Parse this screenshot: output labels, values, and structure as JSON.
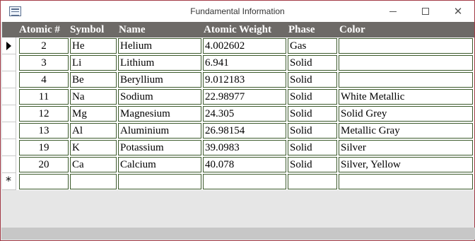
{
  "window": {
    "title": "Fundamental Information",
    "icon": "form-view-icon"
  },
  "controls": {
    "minimize_icon": "minimize-icon",
    "maximize_icon": "maximize-icon",
    "close_icon": "close-icon"
  },
  "table": {
    "headers": [
      "Atomic #",
      "Symbol",
      "Name",
      "Atomic Weight",
      "Phase",
      "Color"
    ],
    "rows": [
      [
        "2",
        "He",
        "Helium",
        "4.002602",
        "Gas",
        ""
      ],
      [
        "3",
        "Li",
        "Lithium",
        "6.941",
        "Solid",
        ""
      ],
      [
        "4",
        "Be",
        "Beryllium",
        "9.012183",
        "Solid",
        ""
      ],
      [
        "11",
        "Na",
        "Sodium",
        "22.98977",
        "Solid",
        "White Metallic"
      ],
      [
        "12",
        "Mg",
        "Magnesium",
        "24.305",
        "Solid",
        "Solid Grey"
      ],
      [
        "13",
        "Al",
        "Aluminium",
        "26.98154",
        "Solid",
        "Metallic Gray"
      ],
      [
        "19",
        "K",
        "Potassium",
        "39.0983",
        "Solid",
        "Silver"
      ],
      [
        "20",
        "Ca",
        "Calcium",
        "40.078",
        "Solid",
        "Silver, Yellow"
      ]
    ],
    "new_record_marker": "*"
  }
}
